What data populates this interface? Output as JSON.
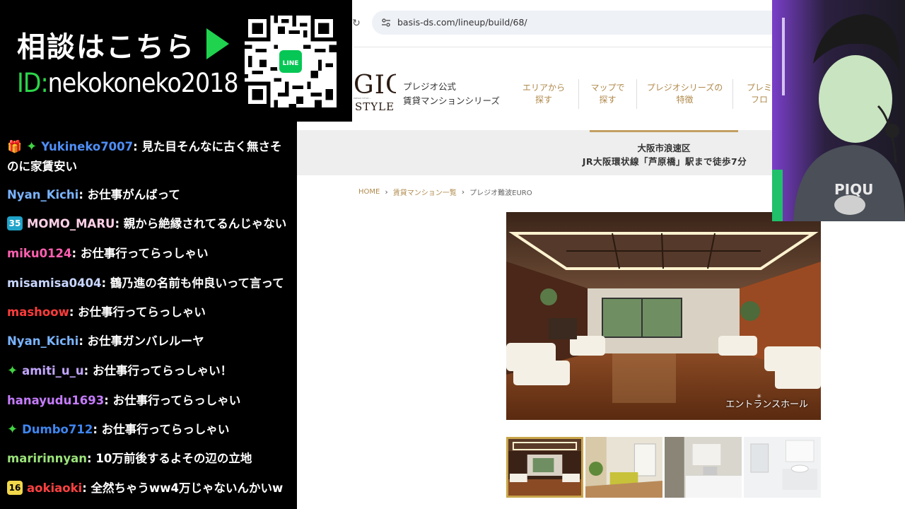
{
  "promo": {
    "headline": "相談はこちら",
    "line_id_prefix": "ID:",
    "line_id_value": "nekokoneko2018",
    "qr_badge": "LINE"
  },
  "browser": {
    "url": "basis-ds.com/lineup/build/68/"
  },
  "site": {
    "logo_text": "GIO",
    "logo_sub": "STYLE",
    "logo_tiny": "PREGIO STYLE ...",
    "tagline_1": "プレジオ公式",
    "tagline_2": "賃貸マンションシリーズ",
    "nav": [
      {
        "label": "エリアから\n探す"
      },
      {
        "label": "マップで\n探す"
      },
      {
        "label": "プレジオシリーズの\n特徴"
      },
      {
        "label": "プレミ\nフロ"
      }
    ],
    "address_line1": "大阪市浪速区",
    "address_line2": "JR大阪環状線「芦原橋」駅まで徒歩7分",
    "breadcrumb": [
      "HOME",
      "賃貸マンション一覧",
      "プレジオ難波EURO"
    ],
    "hero_caption": "エントランスホール"
  },
  "chat": {
    "messages": [
      {
        "badge": "gift+sparkle",
        "user": "Yukineko7007",
        "color": "#4f8ff7",
        "text": ": 見た目そんなに古く無さそ",
        "cont": "のに家賃安い"
      },
      {
        "badge": "",
        "user": "Nyan_Kichi",
        "color": "#7ab4ff",
        "text": ": お仕事がんばって"
      },
      {
        "badge": "35",
        "user": "MOMO_MARU",
        "color": "#ffd0e6",
        "text": ": 親から絶縁されてるんじゃない"
      },
      {
        "badge": "",
        "user": "miku0124",
        "color": "#ff5fb0",
        "text": ": お仕事行ってらっしゃい"
      },
      {
        "badge": "",
        "user": "misamisa0404",
        "color": "#c8d6ff",
        "text": ": 鶴乃進の名前も仲良いって言って"
      },
      {
        "badge": "",
        "user": "mashoow",
        "color": "#ff3b3b",
        "text": ": お仕事行ってらっしゃい"
      },
      {
        "badge": "",
        "user": "Nyan_Kichi",
        "color": "#7ab4ff",
        "text": ": お仕事ガンバレルーヤ"
      },
      {
        "badge": "sparkle",
        "user": "amiti_u_u",
        "color": "#c3a6ff",
        "text": ": お仕事行ってらっしゃい！"
      },
      {
        "badge": "",
        "user": "hanayudu1693",
        "color": "#c67cff",
        "text": ": お仕事行ってらっしゃい"
      },
      {
        "badge": "sparkle",
        "user": "Dumbo712",
        "color": "#3f86f0",
        "text": ": お仕事行ってらっしゃい"
      },
      {
        "badge": "",
        "user": "maririnnyan",
        "color": "#9be37a",
        "text": ": 10万前後するよその辺の立地"
      },
      {
        "badge": "16",
        "user": "aokiaoki",
        "color": "#ff4040",
        "text": ": 全然ちゃうww4万じゃないんかいw"
      }
    ]
  }
}
